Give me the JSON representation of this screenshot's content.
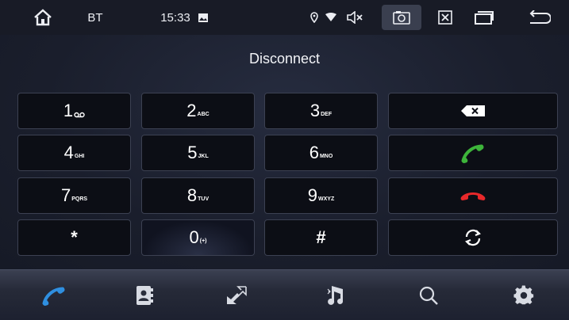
{
  "status_bar": {
    "source_label": "BT",
    "time": "15:33",
    "icons": [
      "home-icon",
      "gallery-icon",
      "location-icon",
      "wifi-icon",
      "mute-icon",
      "screenshot-icon",
      "close-icon",
      "recent-apps-icon",
      "back-icon"
    ]
  },
  "call_status": "Disconnect",
  "keypad": [
    {
      "digit": "1",
      "sub": "ꝏ"
    },
    {
      "digit": "2",
      "sub": "ABC"
    },
    {
      "digit": "3",
      "sub": "DEF"
    },
    {
      "digit": "4",
      "sub": "GHI"
    },
    {
      "digit": "5",
      "sub": "JKL"
    },
    {
      "digit": "6",
      "sub": "MNO"
    },
    {
      "digit": "7",
      "sub": "PQRS"
    },
    {
      "digit": "8",
      "sub": "TUV"
    },
    {
      "digit": "9",
      "sub": "WXYZ"
    },
    {
      "digit": "*",
      "sub": ""
    },
    {
      "digit": "0",
      "sub": "(+)"
    },
    {
      "digit": "#",
      "sub": ""
    }
  ],
  "actions": [
    "backspace-icon",
    "call-icon",
    "hangup-icon",
    "switch-icon"
  ],
  "bottom_nav": [
    "dialer-icon",
    "contacts-icon",
    "call-log-icon",
    "bt-music-icon",
    "search-icon",
    "settings-icon"
  ],
  "colors": {
    "call": "#3db43a",
    "hangup": "#e8282a",
    "active_tab": "#2f8fe0"
  }
}
